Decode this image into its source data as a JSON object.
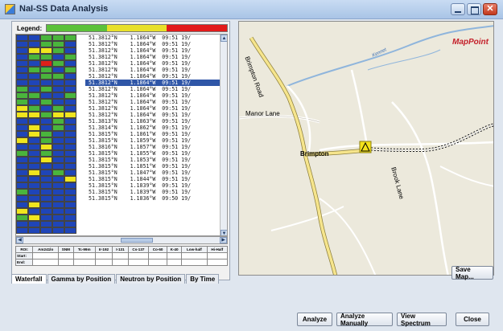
{
  "window": {
    "title": "NaI-SS Data Analysis"
  },
  "legend": {
    "label": "Legend:",
    "colors": [
      "#5cc13a",
      "#e8e02a",
      "#e21a1a"
    ]
  },
  "heatmap": {
    "colors": {
      "B": "#1f45b8",
      "G": "#4ab53c",
      "Y": "#f0e51e",
      "R": "#e0201a"
    },
    "rows": [
      "BBGGG",
      "BBGGB",
      "BYYGB",
      "BGGBG",
      "BBRGB",
      "BGGBG",
      "BBGGB",
      "BBBBB",
      "GBGBB",
      "GGBBG",
      "GBGBB",
      "YGBGB",
      "YYGYY",
      "BBBGB",
      "BYBGB",
      "BYGBB",
      "YBGBB",
      "BBYBB",
      "GBGBB",
      "BBYBB",
      "BBBBB",
      "BYBGB",
      "BBBBY",
      "BBBBB",
      "GBBBB",
      "BBBBB",
      "BYBBB",
      "YBBBB",
      "GYBBB",
      "BBBBB",
      "BBBBB"
    ]
  },
  "data_rows": [
    "51.3812°N    1.1864°W  09:51 19/",
    "51.3812°N    1.1864°W  09:51 19/",
    "51.3812°N    1.1864°W  09:51 19/",
    "51.3812°N    1.1864°W  09:51 19/",
    "51.3812°N    1.1864°W  09:51 19/",
    "51.3812°N    1.1864°W  09:51 19/",
    "51.3812°N    1.1864°W  09:51 19/",
    "51.3812°N    1.1864°W  09:51 19/",
    "51.3812°N    1.1864°W  09:51 19/",
    "51.3812°N    1.1864°W  09:51 19/",
    "51.3812°N    1.1864°W  09:51 19/",
    "51.3812°N    1.1864°W  09:51 19/",
    "51.3812°N    1.1864°W  09:51 19/",
    "51.3813°N    1.1863°W  09:51 19/",
    "51.3814°N    1.1862°W  09:51 19/",
    "51.3815°N    1.1861°W  09:51 19/",
    "51.3815°N    1.1859°W  09:51 19/",
    "51.3816°N    1.1857°W  09:51 19/",
    "51.3815°N    1.1855°W  09:51 19/",
    "51.3815°N    1.1853°W  09:51 19/",
    "51.3815°N    1.1851°W  09:51 19/",
    "51.3815°N    1.1847°W  09:51 19/",
    "51.3815°N    1.1844°W  09:51 19/",
    "51.3815°N    1.1839°W  09:51 19/",
    "51.3815°N    1.1839°W  09:51 19/",
    "51.3815°N    1.1836°W  09:50 19/"
  ],
  "selected_row": 7,
  "roi": {
    "headers": [
      "ROI:",
      "Am241lo",
      "SNM",
      "Tc-99m",
      "Ir-192",
      "I-131",
      "Cs-137",
      "Co-60",
      "K-40",
      "Low-half",
      "Hi-Half"
    ],
    "start": [
      "Start:",
      "",
      "",
      "",
      "",
      "",
      "",
      "",
      "",
      "",
      ""
    ],
    "end": [
      "End:",
      "",
      "",
      "",
      "",
      "",
      "",
      "",
      "",
      "",
      ""
    ]
  },
  "tabs": [
    "Waterfall",
    "Gamma by Position",
    "Neutron by Position",
    "By Time"
  ],
  "map": {
    "brand": "MapPoint",
    "labels": {
      "brimpton_road": "Brimpton Road",
      "manor_lane": "Manor Lane",
      "brimpton": "Brimpton",
      "brook_lane": "Brook Lane",
      "river": "Kennet"
    }
  },
  "buttons": {
    "save_map": "Save Map...",
    "analyze": "Analyze",
    "analyze_manually": "Analyze Manually",
    "view_spectrum": "View Spectrum",
    "close": "Close"
  }
}
